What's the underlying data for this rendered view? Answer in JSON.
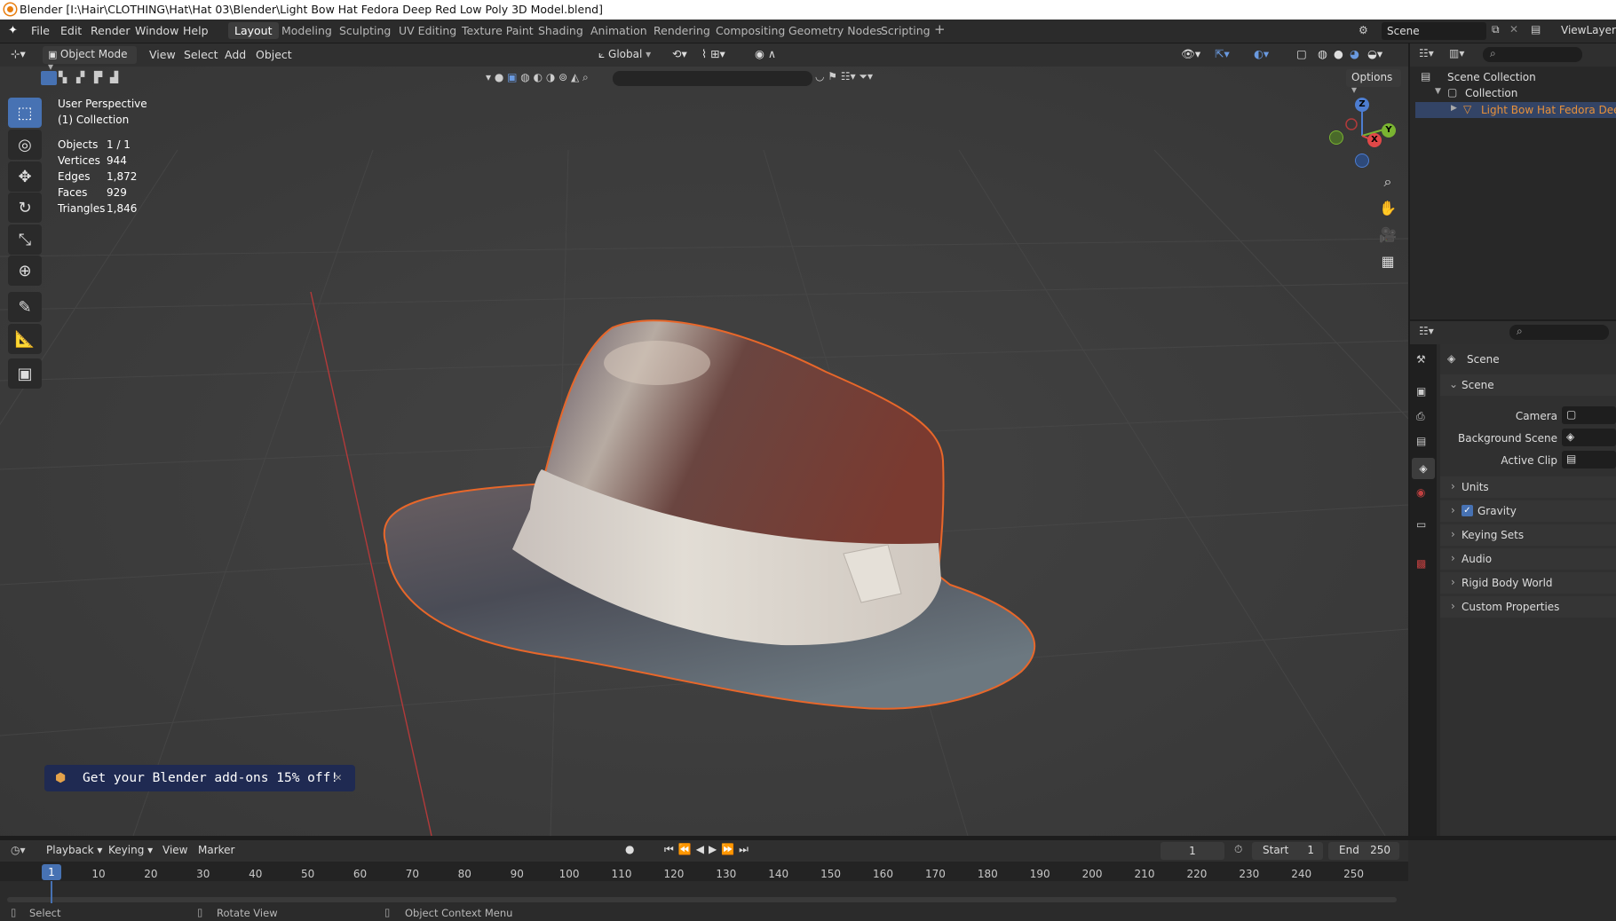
{
  "window": {
    "title": "Blender [I:\\Hair\\CLOTHING\\Hat\\Hat 03\\Blender\\Light Bow Hat Fedora Deep Red Low Poly 3D Model.blend]"
  },
  "menu": [
    "File",
    "Edit",
    "Render",
    "Window",
    "Help"
  ],
  "workspaces": {
    "active": "Layout",
    "tabs": [
      "Modeling",
      "Sculpting",
      "UV Editing",
      "Texture Paint",
      "Shading",
      "Animation",
      "Rendering",
      "Compositing",
      "Geometry Nodes",
      "Scripting"
    ],
    "add": "+"
  },
  "scene_selector": {
    "scene": "Scene",
    "view_layer": "ViewLayer"
  },
  "viewport_header": {
    "mode": "Object Mode",
    "menus": [
      "View",
      "Select",
      "Add",
      "Object"
    ],
    "orientation": "Global",
    "options": "Options"
  },
  "overlay_text": {
    "view": "User Perspective",
    "collection": "(1) Collection",
    "stats": [
      {
        "label": "Objects",
        "value": "1 / 1"
      },
      {
        "label": "Vertices",
        "value": "944"
      },
      {
        "label": "Edges",
        "value": "1,872"
      },
      {
        "label": "Faces",
        "value": "929"
      },
      {
        "label": "Triangles",
        "value": "1,846"
      }
    ]
  },
  "gizmo": {
    "z": "Z",
    "y": "Y",
    "x": "X"
  },
  "toast": {
    "text": "Get your Blender add-ons 15% off!",
    "close": "✕"
  },
  "outliner": {
    "scene_collection": "Scene Collection",
    "collection": "Collection",
    "object": "Light Bow Hat Fedora Deep R"
  },
  "properties": {
    "context": "Scene",
    "panel": "Scene",
    "fields": [
      {
        "label": "Camera"
      },
      {
        "label": "Background Scene"
      },
      {
        "label": "Active Clip"
      }
    ],
    "sections": [
      "Units",
      "Gravity",
      "Keying Sets",
      "Audio",
      "Rigid Body World",
      "Custom Properties"
    ],
    "gravity_checked": true
  },
  "timeline": {
    "menus": [
      "Playback",
      "Keying",
      "View",
      "Marker"
    ],
    "current_frame": "1",
    "start_label": "Start",
    "start": "1",
    "end_label": "End",
    "end": "250",
    "ticks": [
      "10",
      "20",
      "30",
      "40",
      "50",
      "60",
      "70",
      "80",
      "90",
      "100",
      "110",
      "120",
      "130",
      "140",
      "150",
      "160",
      "170",
      "180",
      "190",
      "200",
      "210",
      "220",
      "230",
      "240",
      "250"
    ],
    "playhead": "1"
  },
  "statusbar": {
    "select": "Select",
    "rotate": "Rotate View",
    "context_menu": "Object Context Menu"
  },
  "colors": {
    "accent": "#4772b3",
    "selection_outline": "#e8672a",
    "background": "#3f3f3f"
  }
}
